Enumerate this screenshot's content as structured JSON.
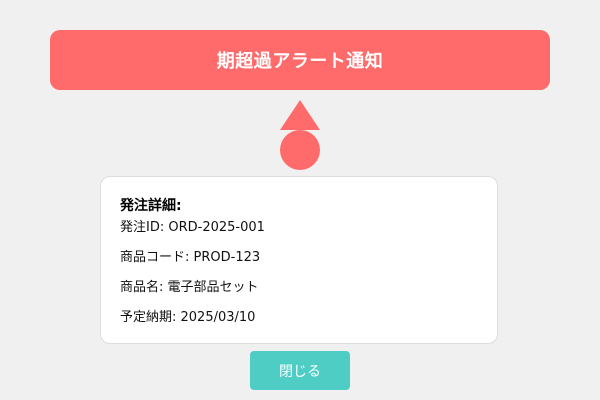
{
  "alert": {
    "title": "期超過アラート通知",
    "color": "#ff6b6b",
    "icon": "warning-marker-icon"
  },
  "details": {
    "heading": "発注詳細:",
    "rows": [
      {
        "label": "発注ID",
        "value": "ORD-2025-001",
        "text": "発注ID: ORD-2025-001"
      },
      {
        "label": "商品コード",
        "value": "PROD-123",
        "text": "商品コード: PROD-123"
      },
      {
        "label": "商品名",
        "value": "電子部品セット",
        "text": "商品名: 電子部品セット"
      },
      {
        "label": "予定納期",
        "value": "2025/03/10",
        "text": "予定納期: 2025/03/10"
      }
    ]
  },
  "actions": {
    "close_label": "閉じる",
    "close_color": "#4ecdc4"
  }
}
